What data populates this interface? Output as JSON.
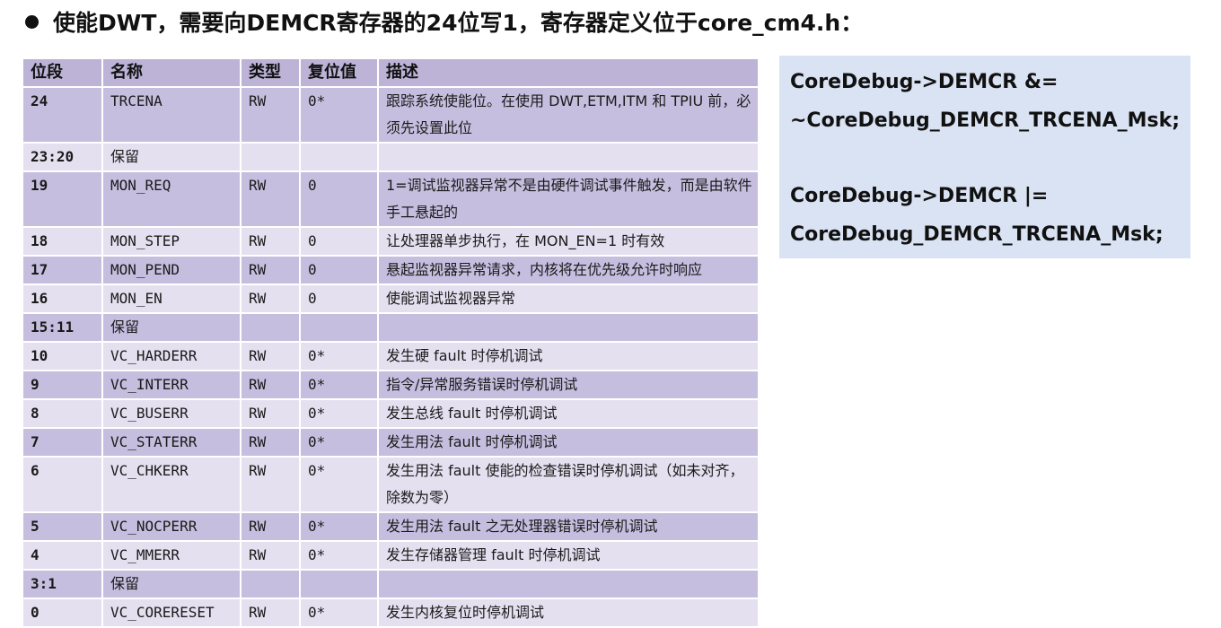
{
  "heading": "使能DWT，需要向DEMCR寄存器的24位写1，寄存器定义位于core_cm4.h：",
  "table": {
    "headers": [
      "位段",
      "名称",
      "类型",
      "复位值",
      "描述"
    ],
    "rows": [
      {
        "bit": "24",
        "name": "TRCENA",
        "type": "RW",
        "reset": "0*",
        "desc": "跟踪系统使能位。在使用 DWT,ETM,ITM 和 TPIU 前，必须先设置此位"
      },
      {
        "bit": "23:20",
        "name": "保留",
        "type": "",
        "reset": "",
        "desc": ""
      },
      {
        "bit": "19",
        "name": "MON_REQ",
        "type": "RW",
        "reset": "0",
        "desc": "1=调试监视器异常不是由硬件调试事件触发，而是由软件手工悬起的"
      },
      {
        "bit": "18",
        "name": "MON_STEP",
        "type": "RW",
        "reset": "0",
        "desc": "让处理器单步执行，在 MON_EN=1 时有效"
      },
      {
        "bit": "17",
        "name": "MON_PEND",
        "type": "RW",
        "reset": "0",
        "desc": "悬起监视器异常请求，内核将在优先级允许时响应"
      },
      {
        "bit": "16",
        "name": "MON_EN",
        "type": "RW",
        "reset": "0",
        "desc": "使能调试监视器异常"
      },
      {
        "bit": "15:11",
        "name": "保留",
        "type": "",
        "reset": "",
        "desc": ""
      },
      {
        "bit": "10",
        "name": "VC_HARDERR",
        "type": "RW",
        "reset": "0*",
        "desc": "发生硬 fault 时停机调试"
      },
      {
        "bit": "9",
        "name": "VC_INTERR",
        "type": "RW",
        "reset": "0*",
        "desc": "指令/异常服务错误时停机调试"
      },
      {
        "bit": "8",
        "name": "VC_BUSERR",
        "type": "RW",
        "reset": "0*",
        "desc": "发生总线 fault 时停机调试"
      },
      {
        "bit": "7",
        "name": "VC_STATERR",
        "type": "RW",
        "reset": "0*",
        "desc": "发生用法 fault 时停机调试"
      },
      {
        "bit": "6",
        "name": "VC_CHKERR",
        "type": "RW",
        "reset": "0*",
        "desc": "发生用法 fault 使能的检查错误时停机调试（如未对齐，除数为零）"
      },
      {
        "bit": "5",
        "name": "VC_NOCPERR",
        "type": "RW",
        "reset": "0*",
        "desc": "发生用法 fault 之无处理器错误时停机调试"
      },
      {
        "bit": "4",
        "name": "VC_MMERR",
        "type": "RW",
        "reset": "0*",
        "desc": "发生存储器管理 fault 时停机调试"
      },
      {
        "bit": "3:1",
        "name": "保留",
        "type": "",
        "reset": "",
        "desc": ""
      },
      {
        "bit": "0",
        "name": "VC_CORERESET",
        "type": "RW",
        "reset": "0*",
        "desc": "发生内核复位时停机调试"
      }
    ]
  },
  "code_box": {
    "line1": "CoreDebug->DEMCR &=",
    "line2": "~CoreDebug_DEMCR_TRCENA_Msk;",
    "line3": "CoreDebug->DEMCR |=",
    "line4": "CoreDebug_DEMCR_TRCENA_Msk;",
    "background": "#dae3f3"
  },
  "colors": {
    "header_row": "#bcb3d6",
    "row_dark": "#c6bedf",
    "row_light": "#e5e0f0"
  }
}
